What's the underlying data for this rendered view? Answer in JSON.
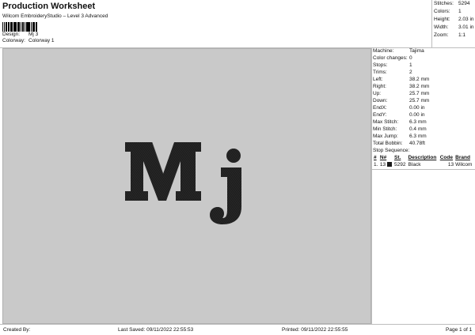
{
  "header": {
    "title": "Production Worksheet",
    "subtitle": "Wilcom EmbroideryStudio – Level 3 Advanced",
    "design_label": "Design:",
    "design_value": "Mj 3",
    "colorway_label": "Colorway:",
    "colorway_value": "Colorway 1"
  },
  "summary": [
    {
      "label": "Stitches:",
      "value": "5294"
    },
    {
      "label": "Colors:",
      "value": "1"
    },
    {
      "label": "Height:",
      "value": "2.03 in"
    },
    {
      "label": "Width:",
      "value": "3.01 in"
    },
    {
      "label": "Zoom:",
      "value": "1:1"
    }
  ],
  "canvas": {
    "background": "#c9c9c9",
    "thread_color": "#1b1b1b",
    "design_text": "Mj"
  },
  "info": [
    {
      "label": "Machine:",
      "value": "Tajima"
    },
    {
      "label": "Color changes:",
      "value": "0"
    },
    {
      "label": "Stops:",
      "value": "1"
    },
    {
      "label": "Trims:",
      "value": "2"
    },
    {
      "label": "Left:",
      "value": "38.2 mm"
    },
    {
      "label": "Right:",
      "value": "38.2 mm"
    },
    {
      "label": "Up:",
      "value": "25.7 mm"
    },
    {
      "label": "Down:",
      "value": "25.7 mm"
    },
    {
      "label": "EndX:",
      "value": "0.00 in"
    },
    {
      "label": "EndY:",
      "value": "0.00 in"
    },
    {
      "label": "Max Stitch:",
      "value": "6.3 mm"
    },
    {
      "label": "Min Stitch:",
      "value": "0.4 mm"
    },
    {
      "label": "Max Jump:",
      "value": "6.3 mm"
    },
    {
      "label": "Total Bobbin:",
      "value": "40.78ft"
    }
  ],
  "stop_sequence": {
    "title": "Stop Sequence:",
    "headers": [
      "#",
      "N#",
      "St.",
      "Description",
      "Code",
      "Brand"
    ],
    "rows": [
      {
        "index": "1.",
        "needle": "13",
        "stitches": "5292",
        "description": "Black",
        "code": "13",
        "brand": "Wilcom",
        "color": "#1b1b1b"
      }
    ]
  },
  "footer": {
    "created_by": "Created By:",
    "last_saved": "Last Saved: 09/11/2022 22:55:53",
    "printed": "Printed: 09/11/2022 22:55:55",
    "page": "Page 1 of 1"
  }
}
